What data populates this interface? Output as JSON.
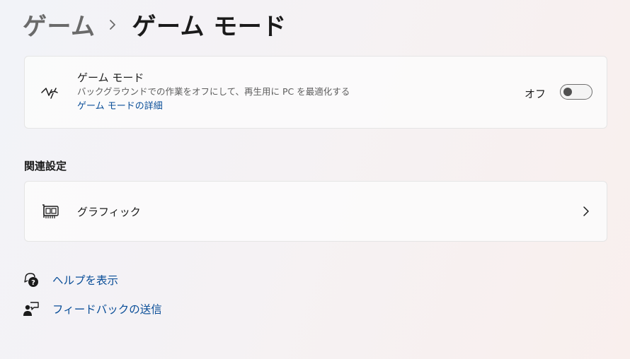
{
  "breadcrumb": {
    "parent": "ゲーム",
    "separator_icon": "chevron-right-icon",
    "current": "ゲーム モード"
  },
  "game_mode": {
    "icon": "game-mode-icon",
    "title": "ゲーム モード",
    "description": "バックグラウンドでの作業をオフにして、再生用に PC を最適化する",
    "link": "ゲーム モードの詳細",
    "toggle_state_label": "オフ",
    "toggle_on": false
  },
  "related": {
    "heading": "関連設定",
    "graphics": {
      "icon": "graphics-card-icon",
      "label": "グラフィック",
      "chevron_icon": "chevron-right-icon"
    }
  },
  "footer_links": {
    "help": {
      "icon": "help-icon",
      "label": "ヘルプを表示"
    },
    "feedback": {
      "icon": "feedback-icon",
      "label": "フィードバックの送信"
    }
  },
  "colors": {
    "accent_link": "#0a4e98",
    "text_primary": "#1b1b1b",
    "text_secondary": "#5c5c5c"
  }
}
